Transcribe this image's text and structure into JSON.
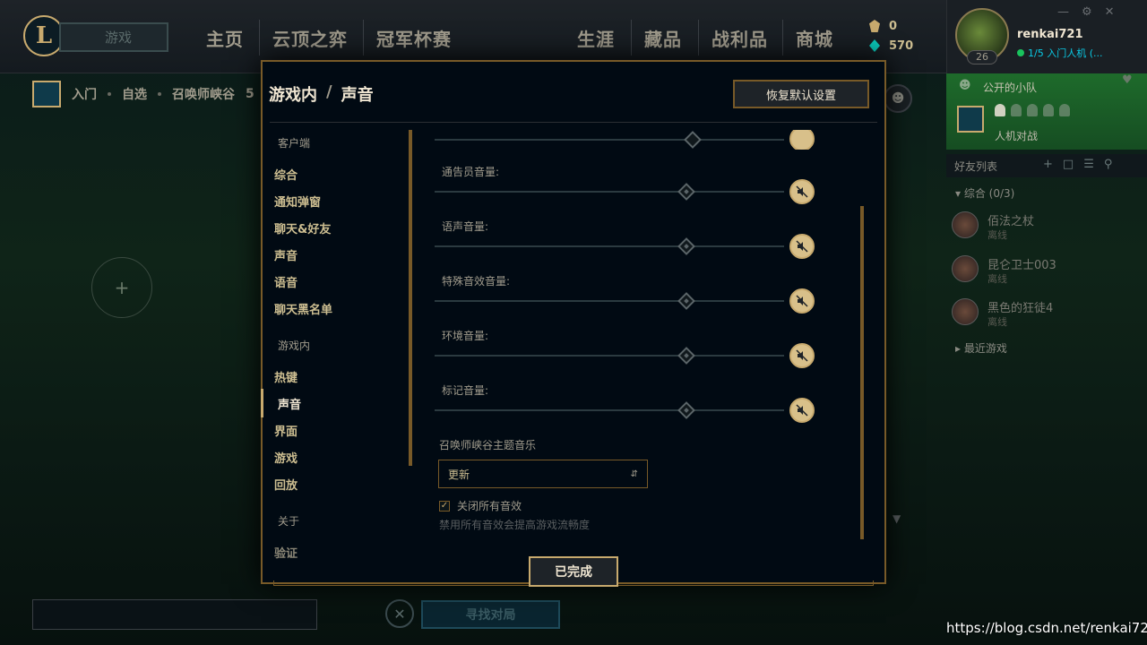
{
  "nav": {
    "play_label": "游戏",
    "items": [
      "主页",
      "云顶之弈",
      "冠军杯赛",
      "生涯",
      "藏品",
      "战利品",
      "商城"
    ]
  },
  "currency": {
    "rp": "0",
    "be": "570"
  },
  "profile": {
    "username": "renkai721",
    "level": "26",
    "status": "1/5 入门人机 (..."
  },
  "party": {
    "title": "公开的小队",
    "mode": "人机对战"
  },
  "friends": {
    "title": "好友列表",
    "group": "综合 (0/3)",
    "list": [
      {
        "name": "佰法之杖",
        "status": "离线"
      },
      {
        "name": "昆仑卫士003",
        "status": "离线"
      },
      {
        "name": "黑色的狂徒4",
        "status": "离线"
      }
    ],
    "recent": "最近游戏"
  },
  "breadcrumb": {
    "items": [
      "入门",
      "自选",
      "召唤师峡谷"
    ],
    "trail": "5"
  },
  "lobby": {
    "find_match": "寻找对局"
  },
  "modal": {
    "title_section": "游戏内",
    "title_sep": "/",
    "title_page": "声音",
    "reset_label": "恢复默认设置",
    "sidebar": {
      "client_section": "客户端",
      "client_items": [
        "综合",
        "通知弹窗",
        "聊天&好友",
        "声音",
        "语音",
        "聊天黑名单"
      ],
      "ingame_section": "游戏内",
      "ingame_items": [
        "热键",
        "声音",
        "界面",
        "游戏",
        "回放"
      ],
      "about_section": "关于",
      "about_items": [
        "验证"
      ]
    },
    "volumes": [
      {
        "label": "通告员音量:",
        "level": 0.72,
        "muted": true
      },
      {
        "label": "语声音量:",
        "level": 0.72,
        "muted": true
      },
      {
        "label": "特殊音效音量:",
        "level": 0.72,
        "muted": true
      },
      {
        "label": "环境音量:",
        "level": 0.72,
        "muted": true
      },
      {
        "label": "标记音量:",
        "level": 0.72,
        "muted": true
      }
    ],
    "theme_label": "召唤师峡谷主题音乐",
    "theme_value": "更新",
    "disable_label": "关闭所有音效",
    "disable_checked": true,
    "disable_hint": "禁用所有音效会提高游戏流畅度",
    "done_label": "已完成"
  },
  "watermark": "https://blog.csdn.net/renkai721",
  "colors": {
    "gold": "#c8aa6e",
    "dark_bg": "#010a13",
    "green_party": "#1e6b2b"
  }
}
